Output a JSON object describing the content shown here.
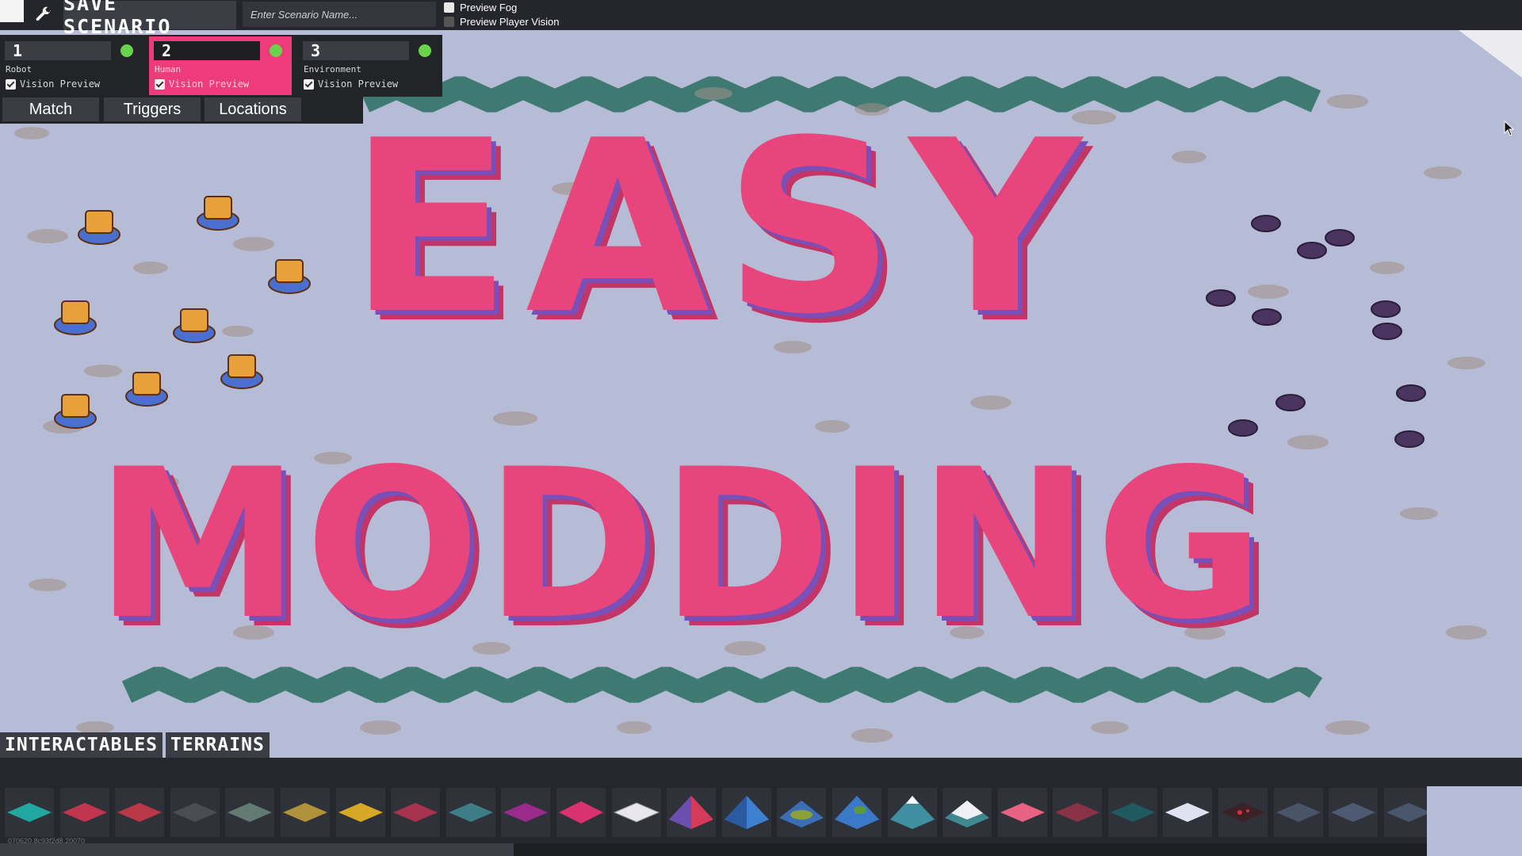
{
  "toolbar": {
    "save_label": "SAVE SCENARIO",
    "scenario_name_placeholder": "Enter Scenario Name...",
    "preview_fog_label": "Preview Fog",
    "preview_player_vision_label": "Preview Player Vision"
  },
  "players": [
    {
      "number": "1",
      "name": "Robot",
      "vision_label": "Vision Preview",
      "vision_checked": true,
      "active": false,
      "status_color": "#68d34a"
    },
    {
      "number": "2",
      "name": "Human",
      "vision_label": "Vision Preview",
      "vision_checked": true,
      "active": true,
      "status_color": "#68d34a"
    },
    {
      "number": "3",
      "name": "Environment",
      "vision_label": "Vision Preview",
      "vision_checked": true,
      "active": false,
      "status_color": "#68d34a"
    }
  ],
  "tabs": {
    "match": "Match",
    "triggers": "Triggers",
    "locations": "Locations"
  },
  "map": {
    "line1": "EASY",
    "line2": "MODDING"
  },
  "bottom": {
    "interactables_label": "INTERACTABLES",
    "terrains_label": "TERRAINS",
    "build_id": "070620.8c93f2d8.20070",
    "terrain_tiles": [
      "teal-water",
      "red-tile",
      "red-tile-2",
      "dark-grey",
      "grey-green",
      "ochre",
      "yellow-sand",
      "magenta-rough",
      "teal-rough",
      "purple-rough",
      "pink-rough",
      "white-outline",
      "red-pyramid",
      "blue-mountain",
      "green-blue-mountain",
      "blue-green-mountain",
      "teal-mountain",
      "snow-mountain",
      "pink-flat",
      "maroon-flat",
      "dark-teal-flat",
      "white-flat",
      "red-lava",
      "slate",
      "slate-2",
      "slate-3"
    ]
  },
  "colors": {
    "accent": "#ee3c7a",
    "status_green": "#68d34a",
    "panel": "#222428",
    "map_ground": "#b6bcd6"
  }
}
